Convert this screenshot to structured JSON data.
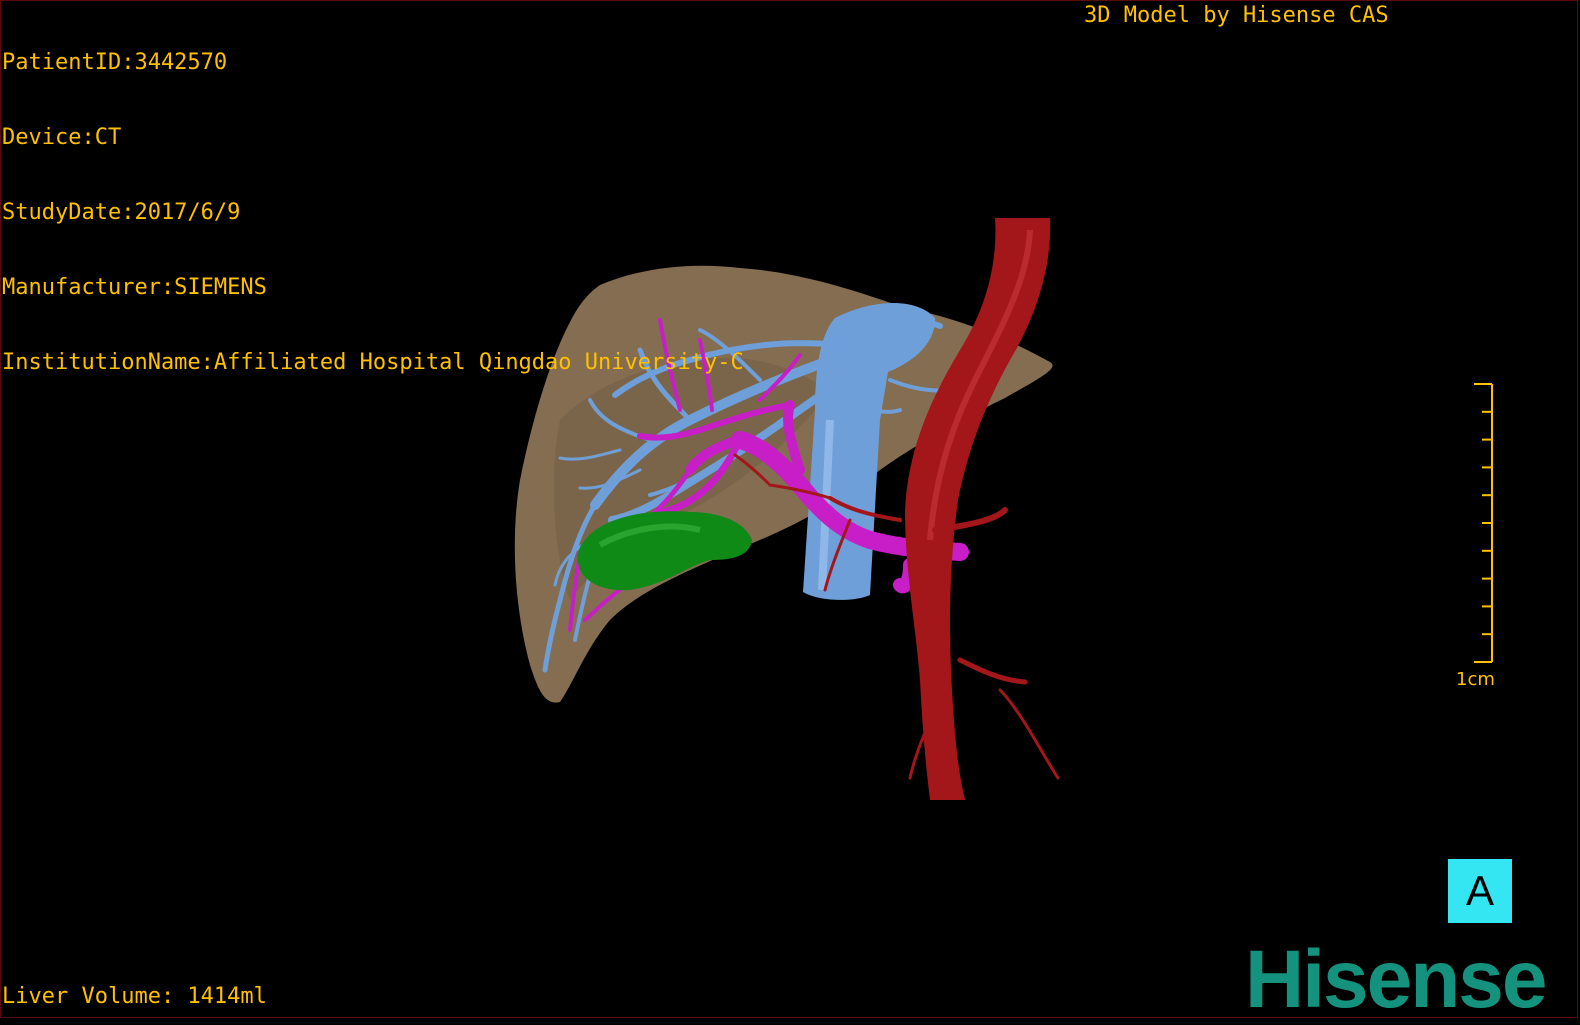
{
  "header": {
    "patient_id": "PatientID:3442570",
    "device": "Device:CT",
    "study_date": "StudyDate:2017/6/9",
    "manufacturer": "Manufacturer:SIEMENS",
    "institution": "InstitutionName:Affiliated Hospital Qingdao University-C"
  },
  "credit": "3D Model by Hisense CAS",
  "footer": {
    "liver_volume": "Liver Volume: 1414ml"
  },
  "scale": {
    "label": "1cm",
    "ticks": 10
  },
  "orientation": {
    "label": "A"
  },
  "brand": {
    "logo_text": "Hisense"
  },
  "colors": {
    "text": "#ffc000",
    "liver": "#8b7355",
    "hepatic_vein": "#6f9fd8",
    "portal_vein": "#c81ec8",
    "artery": "#a3161a",
    "gallbladder": "#0f8a16",
    "orientation_box": "#33e6f2",
    "brand": "#14927e"
  },
  "model": {
    "structures": [
      "liver",
      "hepatic-vein",
      "inferior-vena-cava",
      "portal-vein",
      "aorta",
      "hepatic-artery",
      "gallbladder"
    ]
  }
}
